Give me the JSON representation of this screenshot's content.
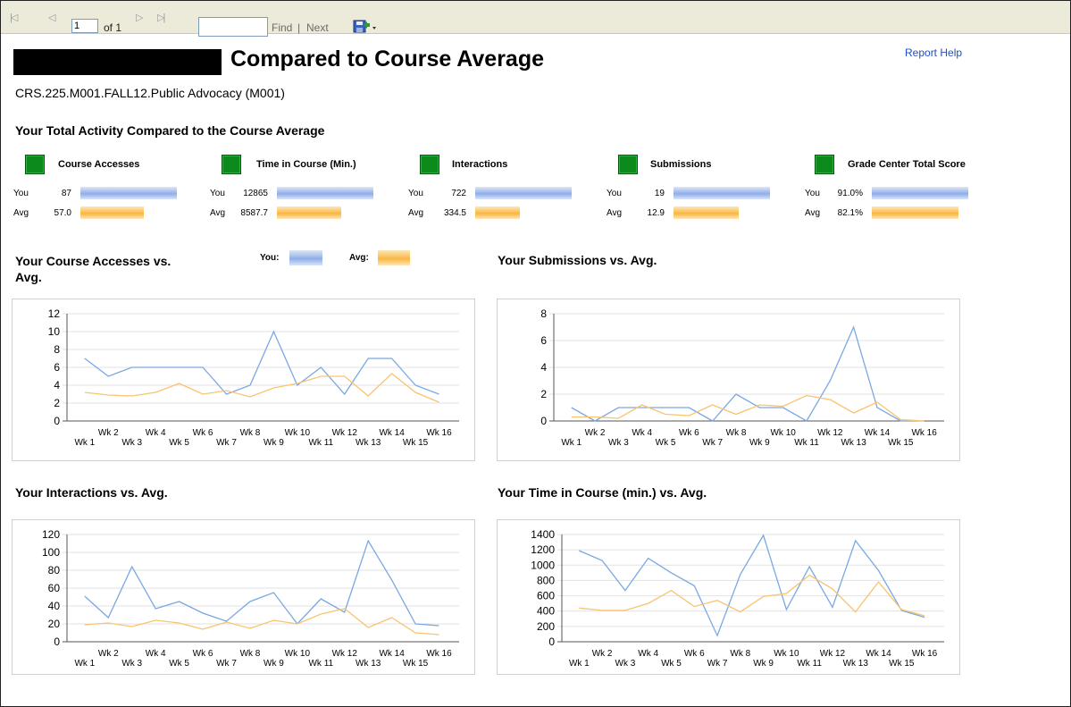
{
  "toolbar": {
    "first_icon": "|◁",
    "prev_icon": "◁",
    "page_value": "1",
    "of_label": "of 1",
    "next_icon": "▷",
    "last_icon": "▷|",
    "find_label": "Find",
    "separator": "|",
    "next_label": "Next",
    "export_icon": "save-icon"
  },
  "header": {
    "title": "Compared to Course Average",
    "help": "Report Help",
    "course": "CRS.225.M001.FALL12.Public Advocacy (M001)"
  },
  "totals": {
    "heading": "Your Total Activity Compared to the Course Average",
    "you_label": "You",
    "avg_label": "Avg",
    "metrics": [
      {
        "title": "Course Accesses",
        "you": "87",
        "avg": "57.0",
        "you_frac": 1.0,
        "avg_frac": 0.655
      },
      {
        "title": "Time in Course (Min.)",
        "you": "12865",
        "avg": "8587.7",
        "you_frac": 1.0,
        "avg_frac": 0.668
      },
      {
        "title": "Interactions",
        "you": "722",
        "avg": "334.5",
        "you_frac": 1.0,
        "avg_frac": 0.463
      },
      {
        "title": "Submissions",
        "you": "19",
        "avg": "12.9",
        "you_frac": 1.0,
        "avg_frac": 0.679
      },
      {
        "title": "Grade Center Total Score",
        "you": "91.0%",
        "avg": "82.1%",
        "you_frac": 1.0,
        "avg_frac": 0.902
      }
    ]
  },
  "legend": {
    "you_label": "You:",
    "avg_label": "Avg:"
  },
  "colors": {
    "you": "#7aa8e2",
    "avg": "#f9c370",
    "green": "#0d8a1c"
  },
  "chart_data": [
    {
      "type": "line",
      "title": "Your Course Accesses vs. Avg.",
      "x": [
        "Wk 1",
        "Wk 2",
        "Wk 3",
        "Wk 4",
        "Wk 5",
        "Wk 6",
        "Wk 7",
        "Wk 8",
        "Wk 9",
        "Wk 10",
        "Wk 11",
        "Wk 12",
        "Wk 13",
        "Wk 14",
        "Wk 15",
        "Wk 16"
      ],
      "ylim": [
        0,
        12
      ],
      "yticks": [
        0,
        2,
        4,
        6,
        8,
        10,
        12
      ],
      "series": [
        {
          "name": "You",
          "values": [
            7,
            5,
            6,
            6,
            6,
            6,
            3,
            4,
            10,
            4,
            6,
            3,
            7,
            7,
            4,
            3
          ]
        },
        {
          "name": "Avg",
          "values": [
            3.2,
            2.9,
            2.8,
            3.2,
            4.2,
            3.0,
            3.4,
            2.7,
            3.7,
            4.2,
            5.0,
            5.0,
            2.8,
            5.3,
            3.2,
            2.1
          ]
        }
      ]
    },
    {
      "type": "line",
      "title": "Your Submissions vs. Avg.",
      "x": [
        "Wk 1",
        "Wk 2",
        "Wk 3",
        "Wk 4",
        "Wk 5",
        "Wk 6",
        "Wk 7",
        "Wk 8",
        "Wk 9",
        "Wk 10",
        "Wk 11",
        "Wk 12",
        "Wk 13",
        "Wk 14",
        "Wk 15",
        "Wk 16"
      ],
      "ylim": [
        0,
        8
      ],
      "yticks": [
        0,
        2,
        4,
        6,
        8
      ],
      "series": [
        {
          "name": "You",
          "values": [
            1,
            0,
            1,
            1,
            1,
            1,
            0,
            2,
            1,
            1,
            0,
            3,
            7,
            1,
            0,
            0
          ]
        },
        {
          "name": "Avg",
          "values": [
            0.3,
            0.3,
            0.2,
            1.2,
            0.5,
            0.4,
            1.2,
            0.5,
            1.2,
            1.1,
            1.9,
            1.6,
            0.6,
            1.4,
            0.1,
            0.0
          ]
        }
      ]
    },
    {
      "type": "line",
      "title": "Your Interactions vs. Avg.",
      "x": [
        "Wk 1",
        "Wk 2",
        "Wk 3",
        "Wk 4",
        "Wk 5",
        "Wk 6",
        "Wk 7",
        "Wk 8",
        "Wk 9",
        "Wk 10",
        "Wk 11",
        "Wk 12",
        "Wk 13",
        "Wk 14",
        "Wk 15",
        "Wk 16"
      ],
      "ylim": [
        0,
        120
      ],
      "yticks": [
        0,
        20,
        40,
        60,
        80,
        100,
        120
      ],
      "series": [
        {
          "name": "You",
          "values": [
            51,
            27,
            84,
            37,
            45,
            32,
            23,
            45,
            55,
            20,
            48,
            33,
            113,
            69,
            20,
            18
          ]
        },
        {
          "name": "Avg",
          "values": [
            19,
            21,
            17,
            24,
            21,
            14,
            22,
            15,
            24,
            20,
            31,
            37,
            16,
            27,
            10,
            8
          ]
        }
      ]
    },
    {
      "type": "line",
      "title": "Your Time in Course (min.) vs. Avg.",
      "x": [
        "Wk 1",
        "Wk 2",
        "Wk 3",
        "Wk 4",
        "Wk 5",
        "Wk 6",
        "Wk 7",
        "Wk 8",
        "Wk 9",
        "Wk 10",
        "Wk 11",
        "Wk 12",
        "Wk 13",
        "Wk 14",
        "Wk 15",
        "Wk 16"
      ],
      "ylim": [
        0,
        1400
      ],
      "yticks": [
        0,
        200,
        400,
        600,
        800,
        1000,
        1200,
        1400
      ],
      "series": [
        {
          "name": "You",
          "values": [
            1190,
            1060,
            670,
            1090,
            900,
            730,
            80,
            880,
            1390,
            420,
            980,
            450,
            1320,
            930,
            410,
            320
          ]
        },
        {
          "name": "Avg",
          "values": [
            440,
            410,
            410,
            500,
            670,
            460,
            540,
            390,
            590,
            630,
            870,
            690,
            390,
            780,
            420,
            340
          ]
        }
      ]
    }
  ]
}
